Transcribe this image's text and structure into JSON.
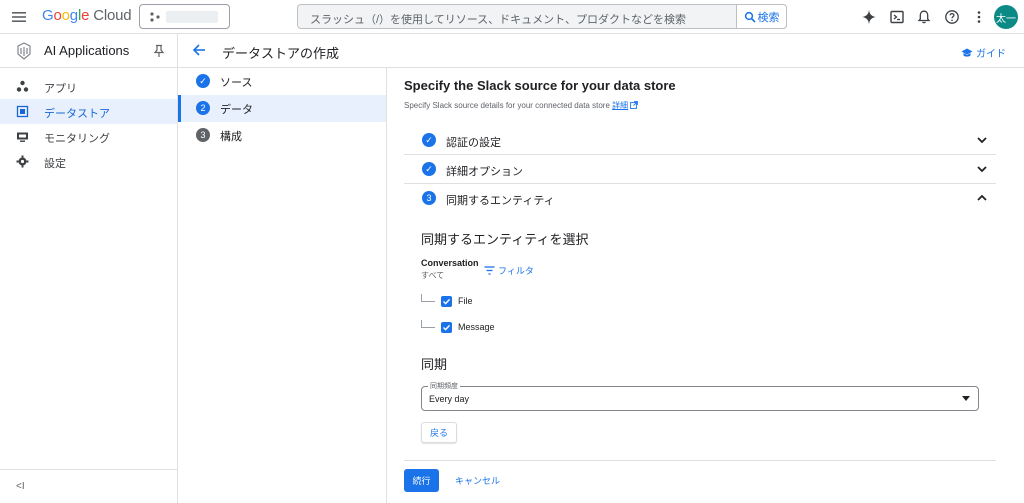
{
  "topbar": {
    "logo": {
      "g1": "G",
      "g2": "o",
      "g3": "o",
      "g4": "g",
      "g5": "l",
      "g6": "e",
      "cloud": " Cloud"
    },
    "search_placeholder": "スラッシュ（/）を使用してリソース、ドキュメント、プロダクトなどを検索",
    "search_button": "検索",
    "avatar": "太一"
  },
  "leftnav": {
    "title": "AI Applications",
    "items": [
      {
        "label": "アプリ"
      },
      {
        "label": "データストア"
      },
      {
        "label": "モニタリング"
      },
      {
        "label": "設定"
      }
    ],
    "collapse": "<I"
  },
  "header": {
    "title": "データストアの作成",
    "guide": "ガイド"
  },
  "stepper": {
    "steps": [
      {
        "num": "✓",
        "label": "ソース"
      },
      {
        "num": "2",
        "label": "データ"
      },
      {
        "num": "3",
        "label": "構成"
      }
    ]
  },
  "main": {
    "title": "Specify the Slack source for your data store",
    "subtitle": "Specify Slack source details for your connected data store",
    "subtitle_link": "詳細",
    "accordions": [
      {
        "num": "✓",
        "label": "認証の設定"
      },
      {
        "num": "✓",
        "label": "詳細オプション"
      },
      {
        "num": "3",
        "label": "同期するエンティティ"
      }
    ],
    "entities_heading": "同期するエンティティを選択",
    "conversation_title": "Conversation",
    "conversation_sub": "すべて",
    "filter_label": "フィルタ",
    "entities": [
      {
        "label": "File"
      },
      {
        "label": "Message"
      }
    ],
    "sync_heading": "同期",
    "sync_freq_label": "同期頻度",
    "sync_freq_value": "Every day",
    "back_button": "戻る",
    "continue_button": "続行",
    "cancel_button": "キャンセル"
  },
  "colors": {
    "accent": "#1a73e8",
    "active_bg": "#e8f0fe",
    "avatar": "#0b8a86"
  }
}
